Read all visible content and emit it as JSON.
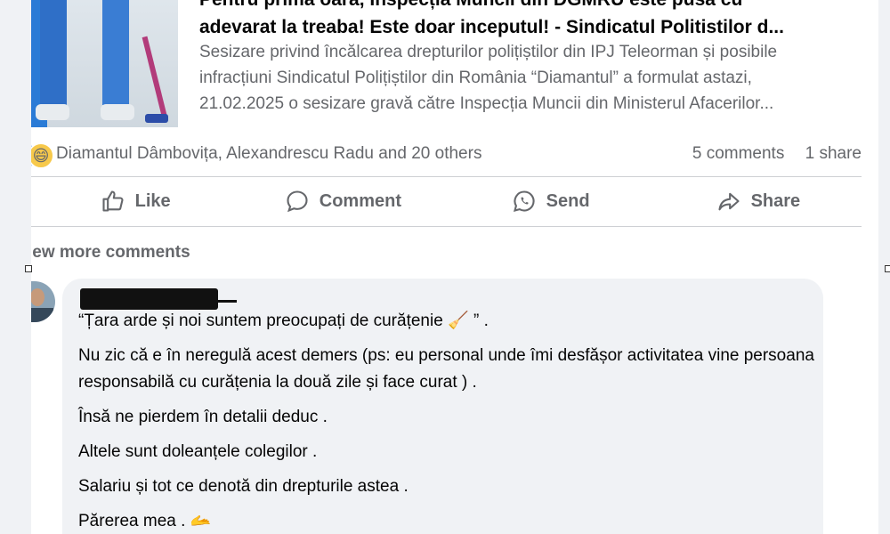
{
  "post": {
    "link_title_line1": "Pentru prima oară, Inspecția Muncii din DGMRU este pusă cu",
    "link_title_line2": "adevarat la treaba! Este doar inceputul! - Sindicatul Politistilor d...",
    "link_desc_line1": "Sesizare privind încălcarea drepturilor polițiștilor din IPJ Teleorman și posibile",
    "link_desc_line2": "infracțiuni Sindicatul Polițiștilor din România “Diamantul” a formulat astazi,",
    "link_desc_line3": "21.02.2025 o sesizare gravă către Inspecția Muncii din Ministerul Afacerilor..."
  },
  "reactions": {
    "icons": [
      "like-icon",
      "haha-icon"
    ],
    "text": "Diamantul Dâmbovița, Alexandrescu Radu and 20 others",
    "comments": "5 comments",
    "shares": "1 share"
  },
  "actions": {
    "like": "Like",
    "comment": "Comment",
    "send": "Send",
    "share": "Share"
  },
  "comments_section": {
    "view_more": "iew more comments",
    "comment": {
      "author_redacted": true,
      "lines": [
        "“Țara arde și noi suntem preocupați de curățenie 🧹 ” .",
        "Nu zic că e în neregulă acest demers (ps: eu personal unde îmi desfășor activitatea vine persoana responsabilă cu curățenia la două zile și face curat ) .",
        "Însă ne pierdem în detalii deduc .",
        "Altele sunt doleanțele colegilor .",
        "Salariu și tot ce denotă din drepturile astea .",
        "Părerea mea . 🫴"
      ]
    }
  },
  "colors": {
    "background": "#f0f2f5",
    "card": "#ffffff",
    "muted_text": "#65676b",
    "like_blue": "#1877f2"
  }
}
